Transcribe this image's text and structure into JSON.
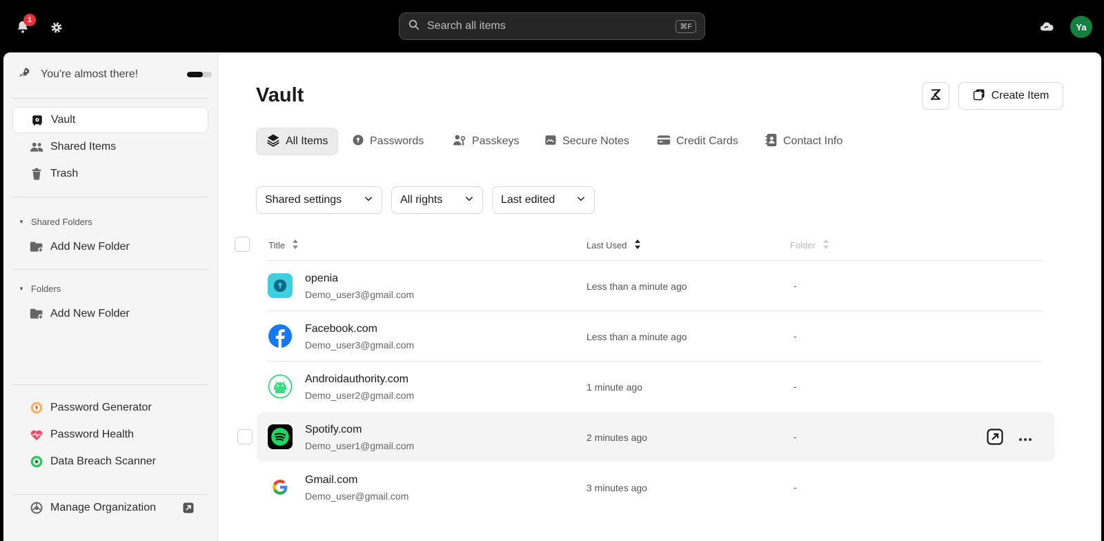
{
  "topbar": {
    "notification_count": "1",
    "search_placeholder": "Search all items",
    "search_shortcut": "⌘F",
    "avatar_initials": "Ya"
  },
  "sidebar": {
    "onboarding": {
      "label": "You're almost there!",
      "progress": 0.65
    },
    "nav": [
      {
        "label": "Vault",
        "icon": "vault-icon",
        "active": true
      },
      {
        "label": "Shared Items",
        "icon": "users-icon"
      },
      {
        "label": "Trash",
        "icon": "trash-icon"
      }
    ],
    "shared_folders": {
      "title": "Shared Folders",
      "add_label": "Add New Folder"
    },
    "folders": {
      "title": "Folders",
      "add_label": "Add New Folder"
    },
    "tools": [
      {
        "label": "Password Generator",
        "icon": "password-generator-icon"
      },
      {
        "label": "Password Health",
        "icon": "heart-pulse-icon"
      },
      {
        "label": "Data Breach Scanner",
        "icon": "breach-scanner-icon"
      }
    ],
    "manage_org": {
      "label": "Manage Organization"
    }
  },
  "main": {
    "title": "Vault",
    "create_label": "Create Item",
    "tabs": [
      {
        "label": "All Items",
        "active": true
      },
      {
        "label": "Passwords"
      },
      {
        "label": "Passkeys"
      },
      {
        "label": "Secure Notes"
      },
      {
        "label": "Credit Cards"
      },
      {
        "label": "Contact Info"
      }
    ],
    "filters": [
      {
        "label": "Shared settings"
      },
      {
        "label": "All rights"
      },
      {
        "label": "Last edited"
      }
    ],
    "columns": {
      "title": "Title",
      "last_used": "Last Used",
      "folder": "Folder"
    },
    "rows": [
      {
        "title": "openia",
        "user": "Demo_user3@gmail.com",
        "last_used": "Less than a minute ago",
        "folder": "-",
        "logo": "openia-logo-icon"
      },
      {
        "title": "Facebook.com",
        "user": "Demo_user3@gmail.com",
        "last_used": "Less than a minute ago",
        "folder": "-",
        "logo": "facebook-logo-icon"
      },
      {
        "title": "Androidauthority.com",
        "user": "Demo_user2@gmail.com",
        "last_used": "1 minute ago",
        "folder": "-",
        "logo": "androidauthority-logo-icon"
      },
      {
        "title": "Spotify.com",
        "user": "Demo_user1@gmail.com",
        "last_used": "2 minutes ago",
        "folder": "-",
        "logo": "spotify-logo-icon"
      },
      {
        "title": "Gmail.com",
        "user": "Demo_user@gmail.com",
        "last_used": "3 minutes ago",
        "folder": "-",
        "logo": "google-logo-icon"
      }
    ]
  }
}
